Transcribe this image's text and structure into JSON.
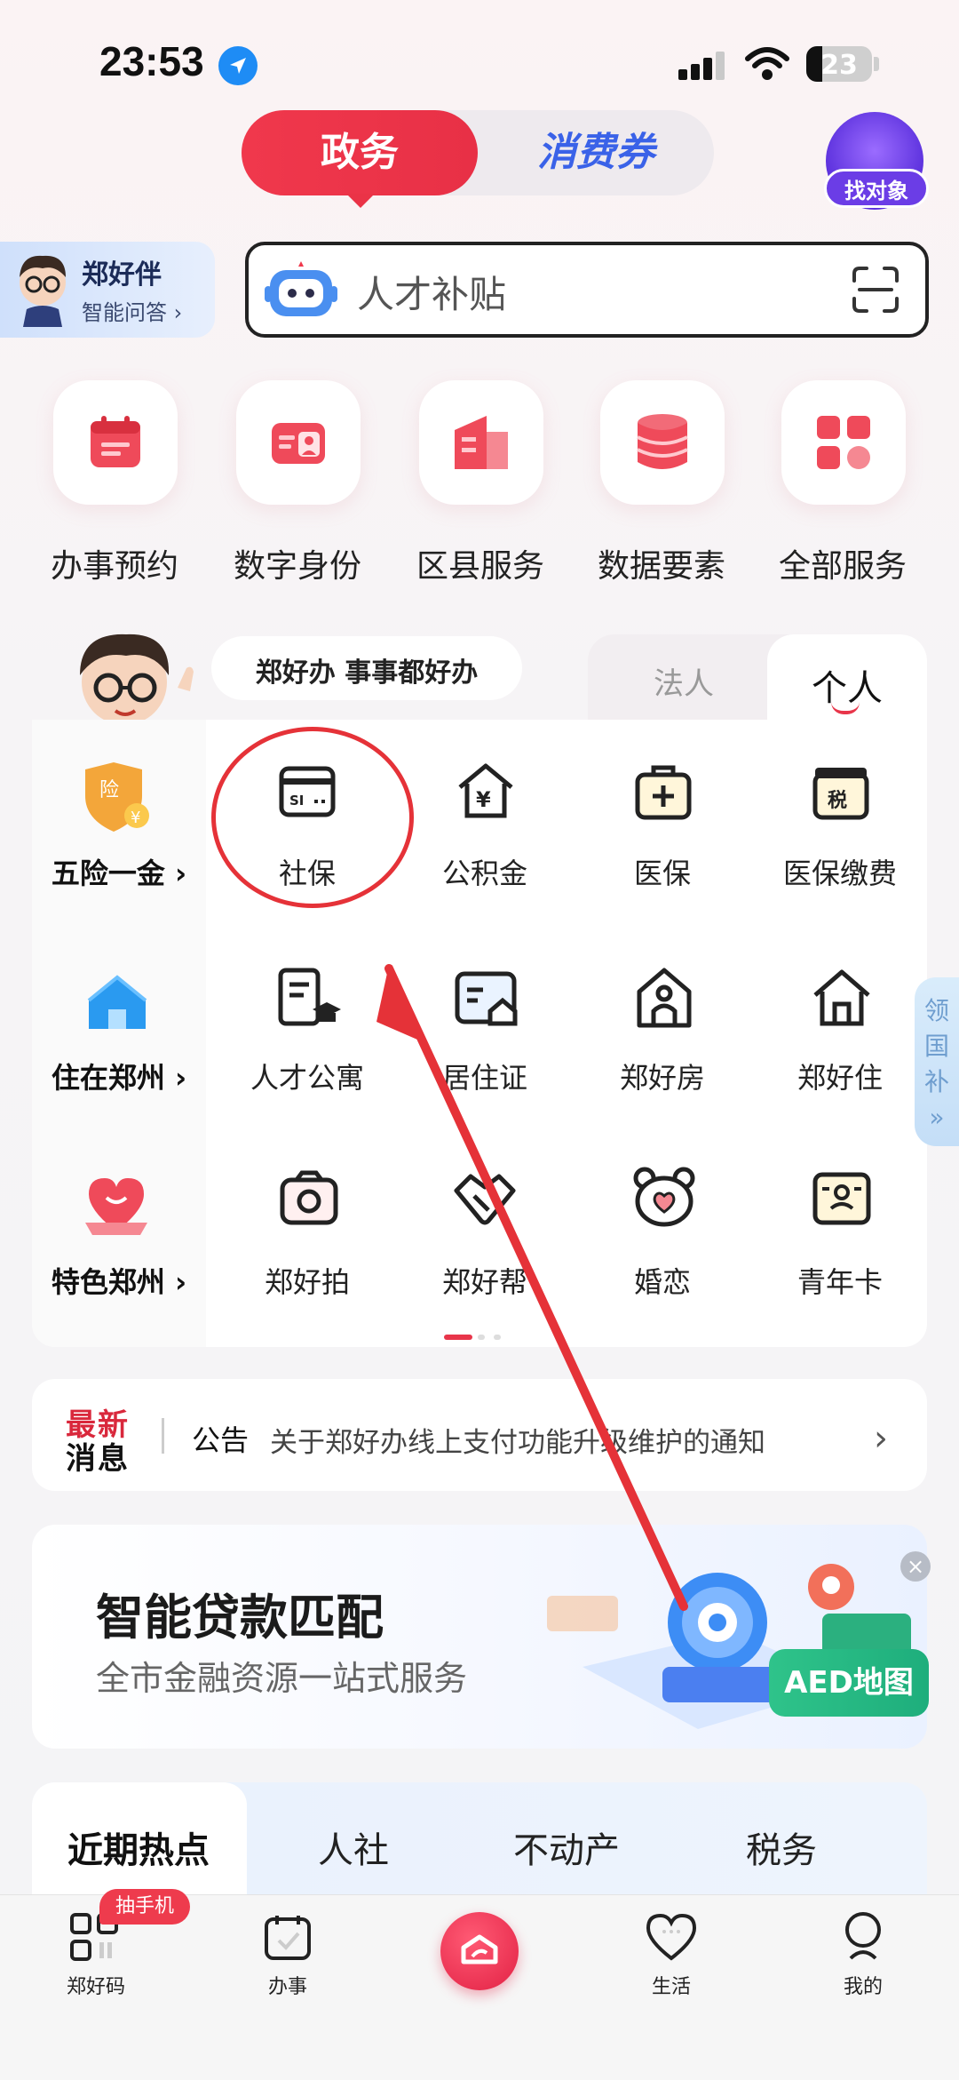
{
  "status_bar": {
    "time": "23:53",
    "battery": "23"
  },
  "top_switch": {
    "active": "政务",
    "other": "消费券"
  },
  "find_partner": {
    "label": "找对象"
  },
  "assistant": {
    "name": "郑好伴",
    "subtitle": "智能问答 ›"
  },
  "search": {
    "placeholder": "人才补贴"
  },
  "quick_services": [
    {
      "label": "办事预约",
      "icon": "calendar-icon"
    },
    {
      "label": "数字身份",
      "icon": "id-card-icon"
    },
    {
      "label": "区县服务",
      "icon": "building-icon"
    },
    {
      "label": "数据要素",
      "icon": "database-icon"
    },
    {
      "label": "全部服务",
      "icon": "grid-icon"
    }
  ],
  "panel": {
    "slogan": "郑好办  事事都好办",
    "tabs": {
      "legal": "法人",
      "personal": "个人"
    },
    "rows": [
      {
        "category": "五险一金 ›",
        "items": [
          "社保",
          "公积金",
          "医保",
          "医保缴费"
        ]
      },
      {
        "category": "住在郑州 ›",
        "items": [
          "人才公寓",
          "居住证",
          "郑好房",
          "郑好住"
        ]
      },
      {
        "category": "特色郑州 ›",
        "items": [
          "郑好拍",
          "郑好帮",
          "婚恋",
          "青年卡"
        ]
      }
    ],
    "side_tab": [
      "领",
      "国",
      "补",
      "»"
    ]
  },
  "news": {
    "badge_line1": "最新",
    "badge_line2": "消息",
    "type": "公告",
    "text": "关于郑好办线上支付功能升级维护的通知"
  },
  "banner": {
    "title": "智能贷款匹配",
    "subtitle": "全市金融资源一站式服务",
    "aed_label": "AED地图"
  },
  "hot_tabs": [
    "近期热点",
    "人社",
    "不动产",
    "税务"
  ],
  "bottom_nav": {
    "badge": "抽手机",
    "items": [
      "郑好码",
      "办事",
      "",
      "生活",
      "我的"
    ]
  },
  "colors": {
    "accent": "#e8354a",
    "blue": "#3a62e8"
  }
}
